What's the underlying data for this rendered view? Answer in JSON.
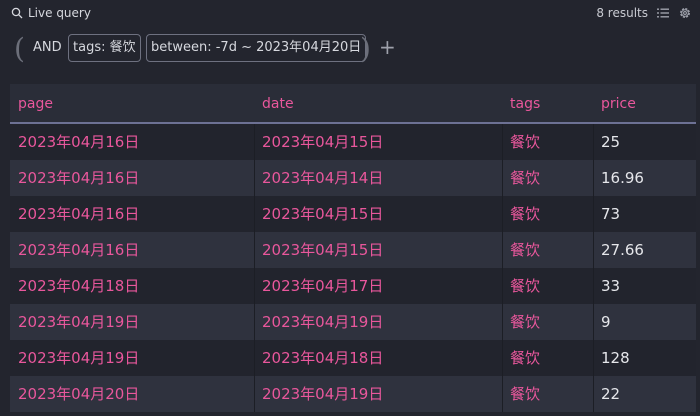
{
  "header": {
    "title": "Live query",
    "results": "8 results"
  },
  "query": {
    "operator": "AND",
    "chips": [
      "tags: 餐饮",
      "between: -7d ~ 2023年04月20日"
    ],
    "add_label": "+"
  },
  "table": {
    "columns": [
      "page",
      "date",
      "tags",
      "price"
    ],
    "rows": [
      [
        "2023年04月16日",
        "2023年04月15日",
        "餐饮",
        "25"
      ],
      [
        "2023年04月16日",
        "2023年04月14日",
        "餐饮",
        "16.96"
      ],
      [
        "2023年04月16日",
        "2023年04月15日",
        "餐饮",
        "73"
      ],
      [
        "2023年04月16日",
        "2023年04月15日",
        "餐饮",
        "27.66"
      ],
      [
        "2023年04月18日",
        "2023年04月17日",
        "餐饮",
        "33"
      ],
      [
        "2023年04月19日",
        "2023年04月19日",
        "餐饮",
        "9"
      ],
      [
        "2023年04月19日",
        "2023年04月18日",
        "餐饮",
        "128"
      ],
      [
        "2023年04月20日",
        "2023年04月19日",
        "餐饮",
        "22"
      ]
    ]
  },
  "colors": {
    "accent_pink": "#e9579c",
    "background": "#23252e",
    "row_alt": "#2f323e"
  }
}
